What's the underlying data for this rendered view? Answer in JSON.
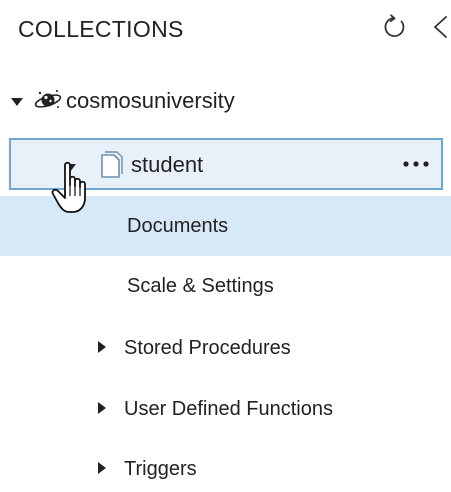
{
  "header": {
    "title": "COLLECTIONS",
    "refresh_icon": "refresh-icon",
    "collapse_icon": "chevron-left-icon"
  },
  "tree": {
    "database": {
      "label": "cosmosuniversity",
      "icon": "database-planet-icon",
      "expanded": true
    },
    "collection": {
      "label": "student",
      "icon": "collection-document-icon",
      "expanded": true,
      "more_label": "•••"
    },
    "items": [
      {
        "label": "Documents",
        "selected": true
      },
      {
        "label": "Scale & Settings",
        "selected": false
      },
      {
        "label": "Stored Procedures",
        "expandable": true
      },
      {
        "label": "User Defined Functions",
        "expandable": true
      },
      {
        "label": "Triggers",
        "expandable": true
      }
    ]
  },
  "colors": {
    "selected_bg": "#d7e9f8",
    "focus_border": "#6fa6d8",
    "text": "#222222"
  }
}
